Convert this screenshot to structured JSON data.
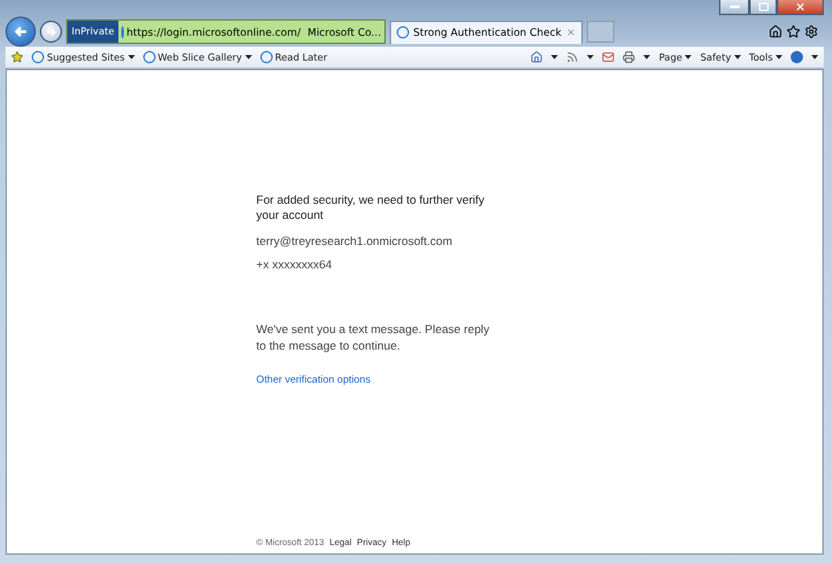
{
  "browser": {
    "inprivate_badge": "InPrivate",
    "address": "https://login.microsoftonline.com/",
    "site_identity": "Microsoft Co...",
    "tabs": [
      {
        "title": "Strong Authentication Check",
        "selected": true
      }
    ],
    "favorites": [
      {
        "label": "Suggested Sites",
        "dropdown": true
      },
      {
        "label": "Web Slice Gallery",
        "dropdown": true
      },
      {
        "label": "Read Later",
        "dropdown": false
      }
    ],
    "commands": [
      {
        "label": "Page"
      },
      {
        "label": "Safety"
      },
      {
        "label": "Tools"
      }
    ]
  },
  "page": {
    "heading": "For added security, we need to further verify your account",
    "account": "terry@treyresearch1.onmicrosoft.com",
    "phone": "+x xxxxxxxx64",
    "message": "We've sent you a text message. Please reply to the message to continue.",
    "link": "Other verification options",
    "footer": {
      "copyright": "© Microsoft 2013",
      "links": [
        "Legal",
        "Privacy",
        "Help"
      ]
    }
  }
}
